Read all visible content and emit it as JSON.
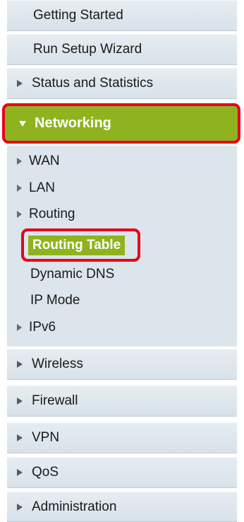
{
  "menu": {
    "top_items": [
      {
        "label": "Getting Started"
      },
      {
        "label": "Run Setup Wizard"
      },
      {
        "label": "Status and Statistics"
      }
    ],
    "networking": {
      "label": "Networking",
      "expanded": true,
      "accent_color": "#8fb31e",
      "highlight_color": "#e8001c",
      "children": [
        {
          "label": "WAN",
          "has_children": true
        },
        {
          "label": "LAN",
          "has_children": true
        },
        {
          "label": "Routing",
          "has_children": true
        },
        {
          "label": "Routing Table",
          "selected": true
        },
        {
          "label": "Dynamic DNS"
        },
        {
          "label": "IP Mode"
        },
        {
          "label": "IPv6",
          "has_children": true
        }
      ]
    },
    "bottom_items": [
      {
        "label": "Wireless"
      },
      {
        "label": "Firewall"
      },
      {
        "label": "VPN"
      },
      {
        "label": "QoS"
      },
      {
        "label": "Administration"
      }
    ]
  }
}
